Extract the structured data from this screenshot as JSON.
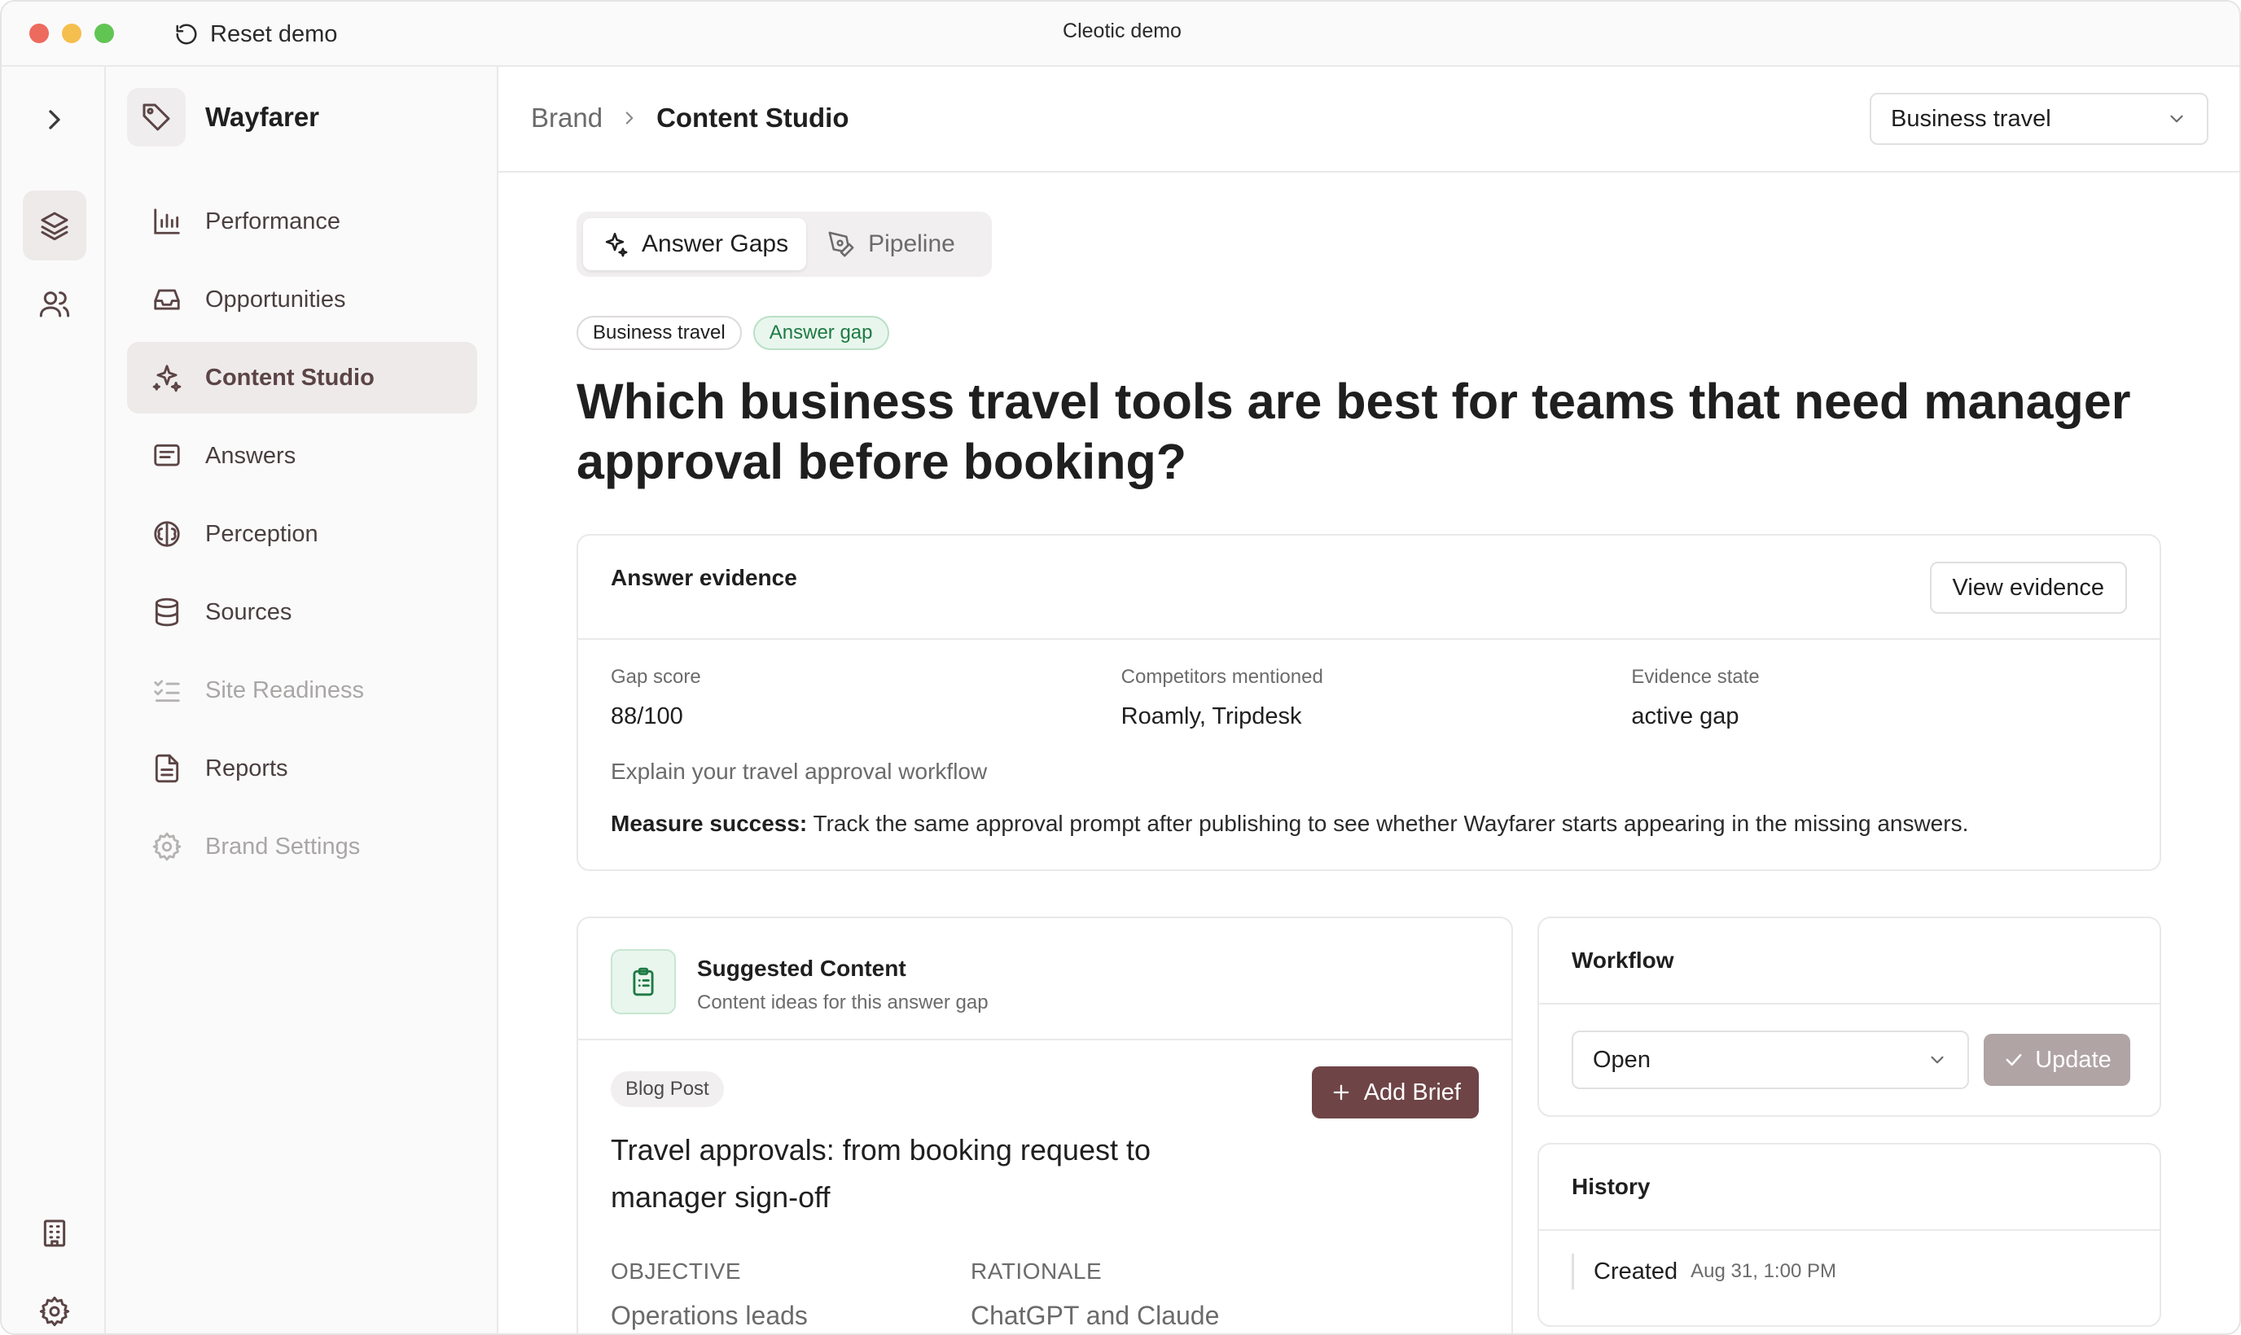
{
  "window": {
    "title": "Cleotic demo",
    "reset_label": "Reset demo"
  },
  "brand": {
    "name": "Wayfarer"
  },
  "nav": {
    "items": [
      {
        "label": "Performance"
      },
      {
        "label": "Opportunities"
      },
      {
        "label": "Content Studio"
      },
      {
        "label": "Answers"
      },
      {
        "label": "Perception"
      },
      {
        "label": "Sources"
      },
      {
        "label": "Site Readiness"
      },
      {
        "label": "Reports"
      },
      {
        "label": "Brand Settings"
      }
    ]
  },
  "breadcrumb": {
    "parent": "Brand",
    "current": "Content Studio"
  },
  "segment_select": {
    "value": "Business travel"
  },
  "tabs": [
    {
      "label": "Answer Gaps"
    },
    {
      "label": "Pipeline"
    }
  ],
  "badges": {
    "segment": "Business travel",
    "status": "Answer gap"
  },
  "question": "Which business travel tools are best for teams that need manager approval before booking?",
  "evidence": {
    "title": "Answer evidence",
    "view_button": "View evidence",
    "stats": [
      {
        "label": "Gap score",
        "value": "88/100"
      },
      {
        "label": "Competitors mentioned",
        "value": "Roamly, Tripdesk"
      },
      {
        "label": "Evidence state",
        "value": "active gap"
      }
    ],
    "subtitle": "Explain your travel approval workflow",
    "measure_label": "Measure success:",
    "measure_text": "Track the same approval prompt after publishing to see whether Wayfarer starts appearing in the missing answers."
  },
  "suggested": {
    "title": "Suggested Content",
    "subtitle": "Content ideas for this answer gap",
    "type_badge": "Blog Post",
    "add_button": "Add Brief",
    "brief_title": "Travel approvals: from booking request to manager sign-off",
    "objective_label": "OBJECTIVE",
    "objective_value": "Operations leads",
    "rationale_label": "RATIONALE",
    "rationale_value": "ChatGPT and Claude"
  },
  "workflow": {
    "title": "Workflow",
    "status_value": "Open",
    "update_button": "Update"
  },
  "history": {
    "title": "History",
    "event": "Created",
    "time": "Aug 31, 1:00 PM"
  },
  "colors": {
    "accent": "#6e4446",
    "success": "#1f7a44",
    "success_bg": "#e9f6ee"
  }
}
